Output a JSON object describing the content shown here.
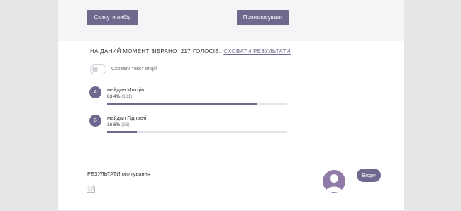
{
  "poll": {
    "reset_label": "Скинути вибір",
    "vote_label": "Проголосувати",
    "summary_prefix": "НА ДАНИЙ МОМЕНТ ЗІБРАНО",
    "total_votes": "217",
    "summary_suffix": "ГОЛОСІВ.",
    "hide_results_label": "СХОВАТИ РЕЗУЛЬТАТИ",
    "hide_options_toggle_label": "Сховати текст опцій",
    "hide_options_toggle_on": false,
    "options": [
      {
        "letter": "A",
        "label": "майдан Митців",
        "percent_text": "83.4%",
        "votes_text": "(181)",
        "fraction": 0.834
      },
      {
        "letter": "B",
        "label": "майдан Гідності",
        "percent_text": "16.6%",
        "votes_text": "(36)",
        "fraction": 0.166
      }
    ]
  },
  "footer": {
    "results_title": "РЕЗУЛЬТАТИ опитування",
    "up_label": "Вгору"
  },
  "colors": {
    "accent": "#6e6a8f",
    "avatar": "#8f7aa8",
    "page_background": "#e6e6e8",
    "top_band": "#f5f5f8"
  },
  "icons": {
    "calendar": "calendar-icon",
    "avatar": "user-avatar-icon"
  }
}
